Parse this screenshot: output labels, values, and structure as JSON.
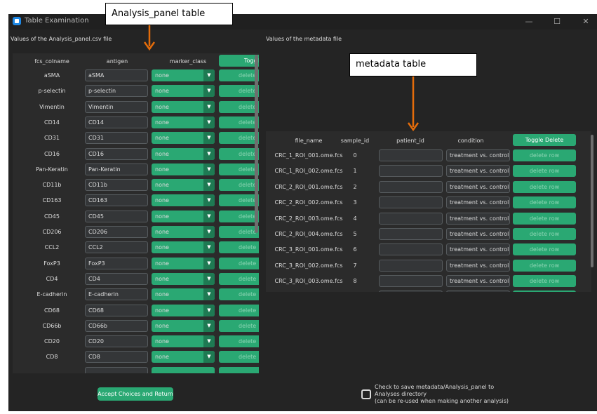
{
  "window": {
    "title": "Table Examination",
    "minimize_glyph": "—",
    "maximize_glyph": "☐",
    "close_glyph": "✕"
  },
  "left_panel": {
    "caption": "Values of the Analysis_panel.csv file",
    "headers": [
      "fcs_colname",
      "antigen",
      "marker_class",
      "Toggle"
    ],
    "rows": [
      {
        "fcs_colname": "aSMA",
        "antigen": "aSMA",
        "marker_class": "none",
        "delete": "delete"
      },
      {
        "fcs_colname": "p-selectin",
        "antigen": "p-selectin",
        "marker_class": "none",
        "delete": "delete"
      },
      {
        "fcs_colname": "Vimentin",
        "antigen": "Vimentin",
        "marker_class": "none",
        "delete": "delete"
      },
      {
        "fcs_colname": "CD14",
        "antigen": "CD14",
        "marker_class": "none",
        "delete": "delete"
      },
      {
        "fcs_colname": "CD31",
        "antigen": "CD31",
        "marker_class": "none",
        "delete": "delete"
      },
      {
        "fcs_colname": "CD16",
        "antigen": "CD16",
        "marker_class": "none",
        "delete": "delete"
      },
      {
        "fcs_colname": "Pan-Keratin",
        "antigen": "Pan-Keratin",
        "marker_class": "none",
        "delete": "delete"
      },
      {
        "fcs_colname": "CD11b",
        "antigen": "CD11b",
        "marker_class": "none",
        "delete": "delete"
      },
      {
        "fcs_colname": "CD163",
        "antigen": "CD163",
        "marker_class": "none",
        "delete": "delete"
      },
      {
        "fcs_colname": "CD45",
        "antigen": "CD45",
        "marker_class": "none",
        "delete": "delete"
      },
      {
        "fcs_colname": "CD206",
        "antigen": "CD206",
        "marker_class": "none",
        "delete": "delete"
      },
      {
        "fcs_colname": "CCL2",
        "antigen": "CCL2",
        "marker_class": "none",
        "delete": "delete"
      },
      {
        "fcs_colname": "FoxP3",
        "antigen": "FoxP3",
        "marker_class": "none",
        "delete": "delete"
      },
      {
        "fcs_colname": "CD4",
        "antigen": "CD4",
        "marker_class": "none",
        "delete": "delete"
      },
      {
        "fcs_colname": "E-cadherin",
        "antigen": "E-cadherin",
        "marker_class": "none",
        "delete": "delete"
      },
      {
        "fcs_colname": "CD68",
        "antigen": "CD68",
        "marker_class": "none",
        "delete": "delete"
      },
      {
        "fcs_colname": "CD66b",
        "antigen": "CD66b",
        "marker_class": "none",
        "delete": "delete"
      },
      {
        "fcs_colname": "CD20",
        "antigen": "CD20",
        "marker_class": "none",
        "delete": "delete"
      },
      {
        "fcs_colname": "CD8",
        "antigen": "CD8",
        "marker_class": "none",
        "delete": "delete"
      }
    ]
  },
  "right_panel": {
    "caption": "Values of the metadata file",
    "headers": [
      "file_name",
      "sample_id",
      "patient_id",
      "condition",
      "Toggle Delete"
    ],
    "rows": [
      {
        "file_name": "CRC_1_ROI_001.ome.fcs",
        "sample_id": "0",
        "patient_id": "",
        "condition": "treatment vs. control",
        "delete": "delete row"
      },
      {
        "file_name": "CRC_1_ROI_002.ome.fcs",
        "sample_id": "1",
        "patient_id": "",
        "condition": "treatment vs. control",
        "delete": "delete row"
      },
      {
        "file_name": "CRC_2_ROI_001.ome.fcs",
        "sample_id": "2",
        "patient_id": "",
        "condition": "treatment vs. control",
        "delete": "delete row"
      },
      {
        "file_name": "CRC_2_ROI_002.ome.fcs",
        "sample_id": "3",
        "patient_id": "",
        "condition": "treatment vs. control",
        "delete": "delete row"
      },
      {
        "file_name": "CRC_2_ROI_003.ome.fcs",
        "sample_id": "4",
        "patient_id": "",
        "condition": "treatment vs. control",
        "delete": "delete row"
      },
      {
        "file_name": "CRC_2_ROI_004.ome.fcs",
        "sample_id": "5",
        "patient_id": "",
        "condition": "treatment vs. control",
        "delete": "delete row"
      },
      {
        "file_name": "CRC_3_ROI_001.ome.fcs",
        "sample_id": "6",
        "patient_id": "",
        "condition": "treatment vs. control",
        "delete": "delete row"
      },
      {
        "file_name": "CRC_3_ROI_002.ome.fcs",
        "sample_id": "7",
        "patient_id": "",
        "condition": "treatment vs. control",
        "delete": "delete row"
      },
      {
        "file_name": "CRC_3_ROI_003.ome.fcs",
        "sample_id": "8",
        "patient_id": "",
        "condition": "treatment vs. control",
        "delete": "delete row"
      }
    ]
  },
  "footer": {
    "accept_label": "Accept Choices and Return",
    "save_line1": "Check to save metadata/Analysis_panel to",
    "save_line2": "Analyses directory",
    "save_line3": "(can be re-used when making another analysis)"
  },
  "annotations": {
    "left_callout": "Analysis_panel table",
    "right_callout": "metadata table",
    "arrow_color": "#e46c0a"
  },
  "colors": {
    "window_bg": "#242424",
    "frame_bg": "#2b2b2b",
    "accent_green": "#2aa873"
  }
}
